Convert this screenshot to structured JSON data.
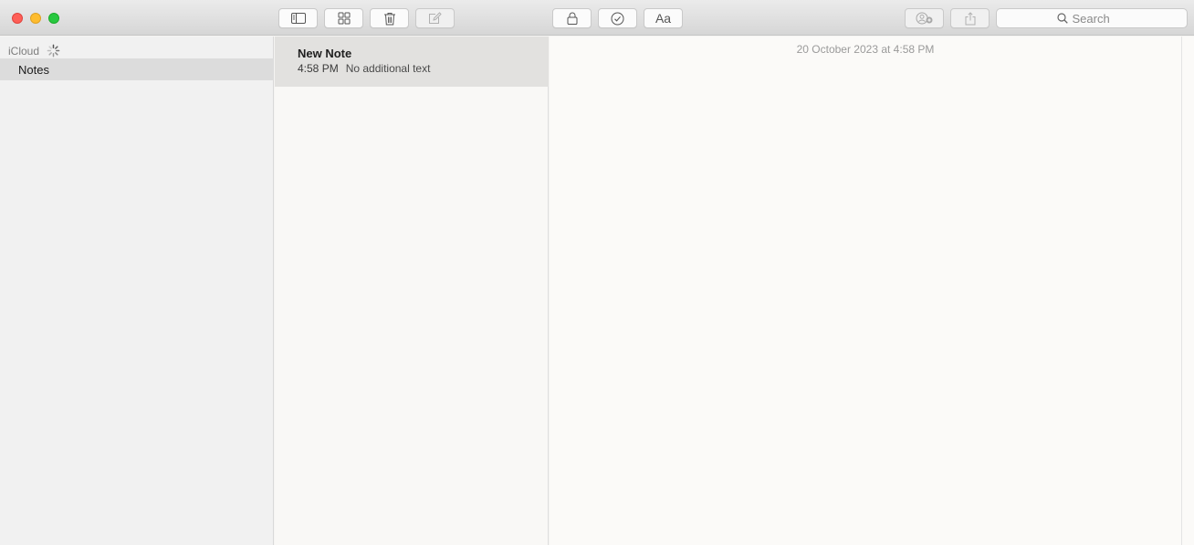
{
  "toolbar": {
    "buttons": {
      "sidebar_toggle": "sidebar-icon",
      "gallery_view": "grid-icon",
      "delete": "trash-icon",
      "compose": "compose-icon",
      "lock": "lock-icon",
      "checklist": "checkmark-circle-icon",
      "format_label": "Aa",
      "add_people": "add-people-icon",
      "share": "share-icon"
    },
    "search": {
      "placeholder": "Search"
    }
  },
  "sidebar": {
    "account_label": "iCloud",
    "folders": [
      {
        "label": "Notes",
        "selected": true
      }
    ]
  },
  "note_list": {
    "items": [
      {
        "title": "New Note",
        "time": "4:58 PM",
        "preview": "No additional text",
        "selected": true
      }
    ]
  },
  "editor": {
    "date_header": "20 October 2023 at 4:58 PM"
  },
  "colors": {
    "close": "#fe5f57",
    "minimize": "#febc2e",
    "maximize": "#28c840",
    "selection": "#e2e1df"
  }
}
